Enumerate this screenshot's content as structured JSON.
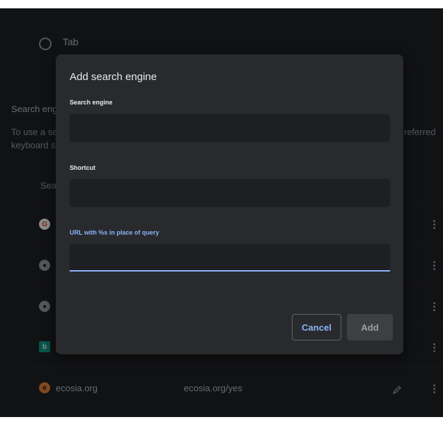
{
  "background": {
    "radio_label": "Tab",
    "section_heading": "Search eng",
    "desc_line1_left": "To use a se",
    "desc_line1_right": "referred",
    "desc_line2_left": "keyboard s",
    "column_header": "Sea",
    "rows": [
      {
        "icon": "google-icon"
      },
      {
        "icon": "globe-icon"
      },
      {
        "icon": "globe-icon"
      },
      {
        "icon": "bing-icon"
      },
      {
        "icon": "ecosia-icon",
        "name": "ecosia.org",
        "keyword": "ecosia.org/yes"
      }
    ]
  },
  "dialog": {
    "title": "Add search engine",
    "fields": {
      "search_engine": {
        "label": "Search engine",
        "value": ""
      },
      "shortcut": {
        "label": "Shortcut",
        "value": ""
      },
      "url": {
        "label": "URL with %s in place of query",
        "value": ""
      }
    },
    "cancel_label": "Cancel",
    "add_label": "Add"
  },
  "colors": {
    "background": "#202124",
    "dialog": "#292a2d",
    "accent": "#8ab4f8",
    "field": "#1e1f22"
  }
}
